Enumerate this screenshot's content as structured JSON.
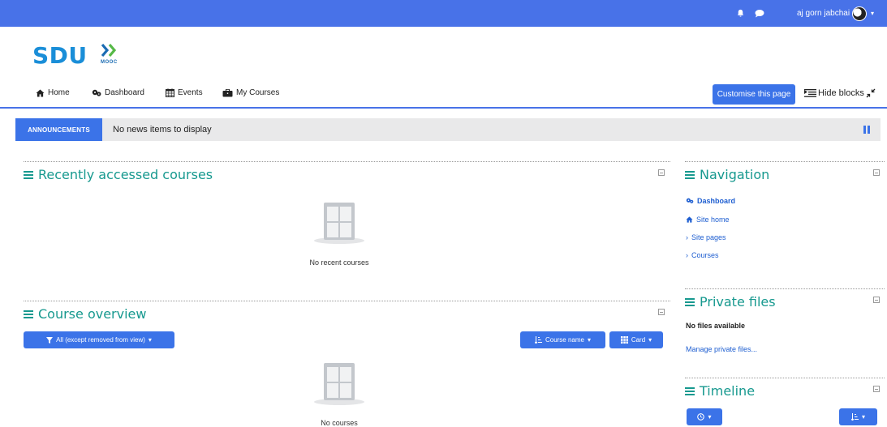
{
  "topbar": {
    "bell_icon": "bell-icon",
    "chat_icon": "chat-icon",
    "username": "aj gorn jabchai",
    "caret": "▾",
    "bg_color": "#4872e8"
  },
  "logo": {
    "text": "SDU",
    "sub": "MOOC",
    "color": "#1a8ed8"
  },
  "nav": {
    "items": [
      {
        "label": "Home",
        "icon": "home-icon"
      },
      {
        "label": "Dashboard",
        "icon": "dashboard-icon"
      },
      {
        "label": "Events",
        "icon": "calendar-icon"
      },
      {
        "label": "My Courses",
        "icon": "briefcase-icon"
      }
    ],
    "customise_label": "Customise this page",
    "hide_blocks_label": "Hide blocks"
  },
  "announcements": {
    "label": "ANNOUNCEMENTS",
    "text": "No news items to display"
  },
  "recent": {
    "title": "Recently accessed courses",
    "empty_text": "No recent courses"
  },
  "overview": {
    "title": "Course overview",
    "filter_label": "All (except removed from view)",
    "sort_label": "Course name",
    "view_label": "Card",
    "empty_text": "No courses"
  },
  "navigation": {
    "title": "Navigation",
    "items": [
      {
        "label": "Dashboard",
        "icon": "dashboard-icon"
      },
      {
        "label": "Site home",
        "icon": "home-icon"
      },
      {
        "label": "Site pages",
        "icon": "chevron-right-icon"
      },
      {
        "label": "Courses",
        "icon": "chevron-right-icon"
      }
    ]
  },
  "private_files": {
    "title": "Private files",
    "empty_text": "No files available",
    "manage_link": "Manage private files..."
  },
  "timeline": {
    "title": "Timeline"
  },
  "colors": {
    "accent": "#3b73e8",
    "heading": "#17998f",
    "link": "#1f5fd1"
  }
}
